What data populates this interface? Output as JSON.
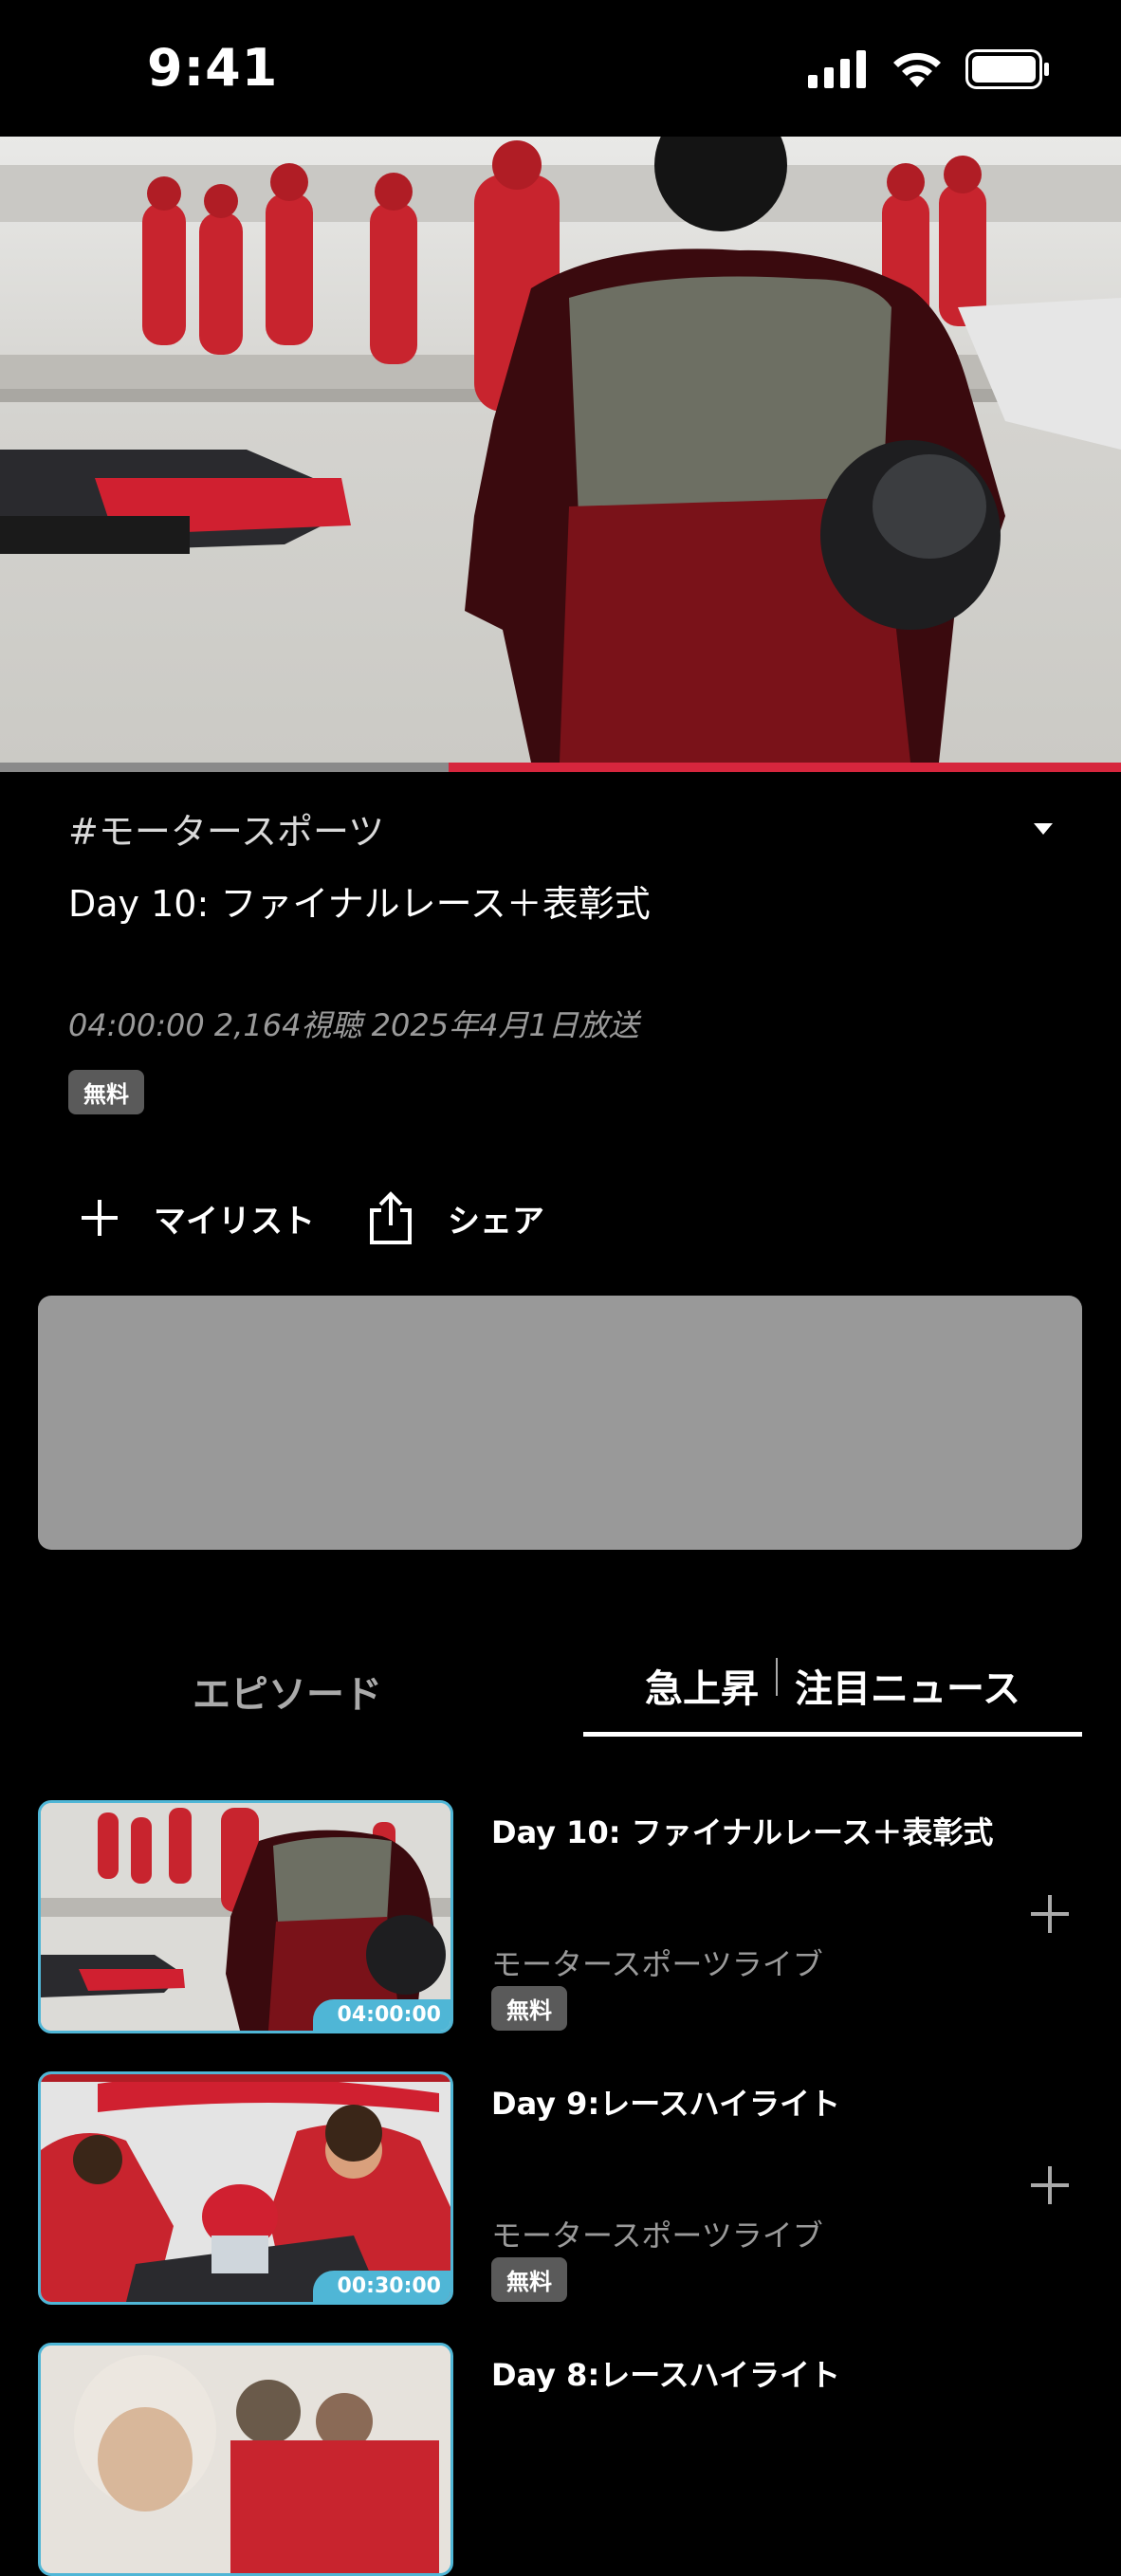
{
  "status_bar": {
    "time": "9:41"
  },
  "player": {
    "progress_fraction": 0.4
  },
  "program": {
    "genre": "#モータースポーツ",
    "title": "Day 10: ファイナルレース＋表彰式",
    "meta": "04:00:00 2,164視聴 2025年4月1日放送",
    "badge": "無料"
  },
  "actions": {
    "mylist_label": "マイリスト",
    "share_label": "シェア"
  },
  "tabs": {
    "episodes": "エピソード",
    "rising": "急上昇",
    "news": "注目ニュース"
  },
  "episodes": [
    {
      "title": "Day 10: ファイナルレース＋表彰式",
      "subtitle": "モータースポーツライブ",
      "badge": "無料",
      "duration": "04:00:00"
    },
    {
      "title": "Day 9:レースハイライト",
      "subtitle": "モータースポーツライブ",
      "badge": "無料",
      "duration": "00:30:00"
    },
    {
      "title": "Day 8:レースハイライト"
    }
  ],
  "colors": {
    "accent_red": "#d6263d",
    "thumb_border": "#4fb6d6",
    "ad_gray": "#999999"
  }
}
